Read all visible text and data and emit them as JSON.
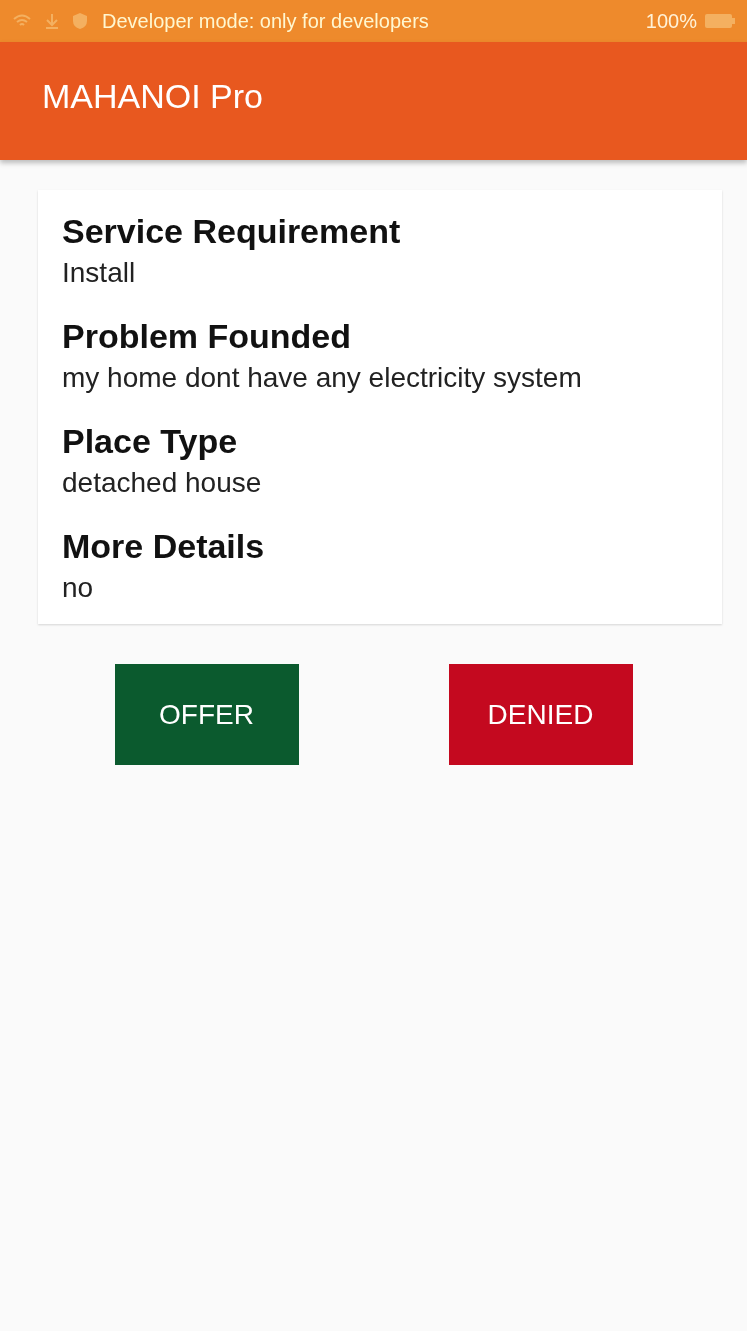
{
  "status_bar": {
    "notice": "Developer mode: only for developers",
    "battery": "100%"
  },
  "app_bar": {
    "title": "MAHANOI Pro"
  },
  "details": [
    {
      "label": "Service Requirement",
      "value": "Install"
    },
    {
      "label": "Problem Founded",
      "value": "my home dont have any electricity system"
    },
    {
      "label": "Place Type",
      "value": "detached house"
    },
    {
      "label": "More Details",
      "value": "no"
    }
  ],
  "buttons": [
    {
      "label": "OFFER",
      "kind": "accept"
    },
    {
      "label": "DENIED",
      "kind": "reject"
    }
  ]
}
